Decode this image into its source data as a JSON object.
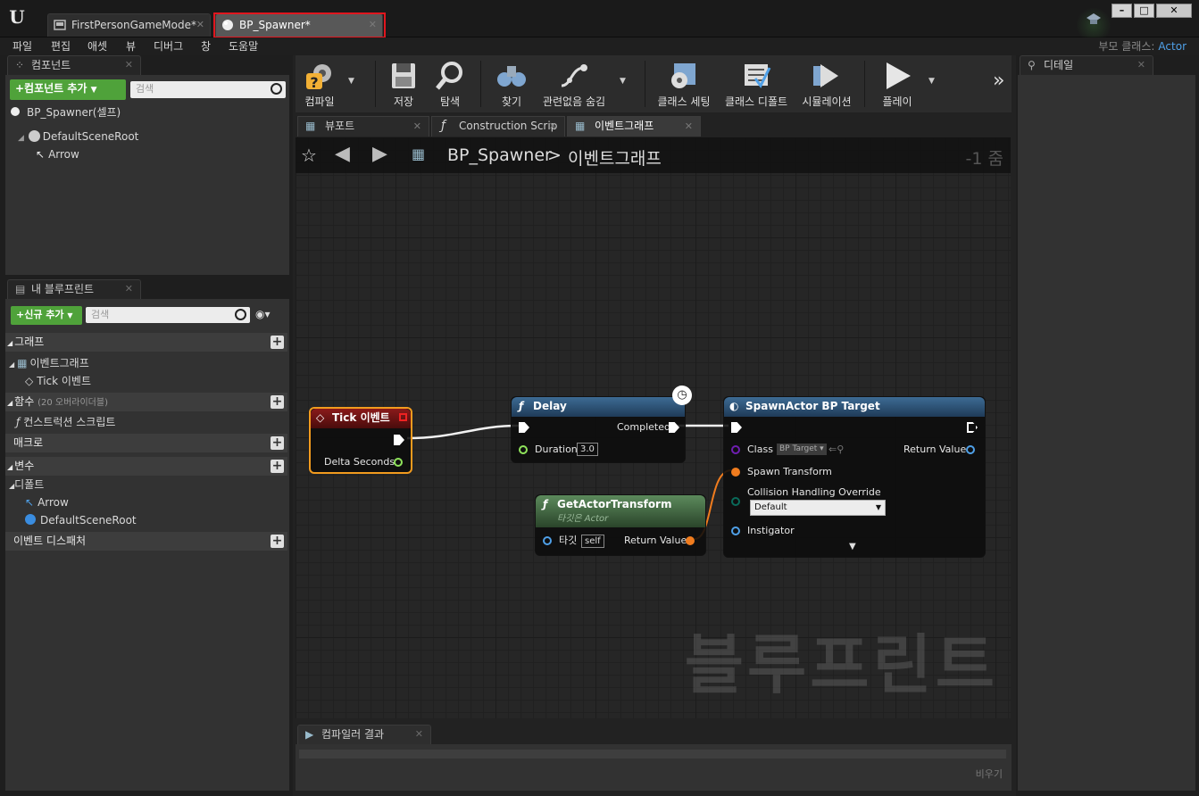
{
  "doc_tabs": [
    {
      "label": "FirstPersonGameMode*"
    },
    {
      "label": "BP_Spawner*"
    }
  ],
  "menu": [
    "파일",
    "편집",
    "애셋",
    "뷰",
    "디버그",
    "창",
    "도움말"
  ],
  "parent_class": {
    "label": "부모 클래스:",
    "value": "Actor"
  },
  "components": {
    "tab": "컴포넌트",
    "add_button": "+컴포넌트 추가",
    "search_placeholder": "검색",
    "self": "BP_Spawner(셀프)",
    "root": "DefaultSceneRoot",
    "child": "Arrow"
  },
  "my_blueprint": {
    "tab": "내 블루프린트",
    "add_button": "+신규 추가",
    "search_placeholder": "검색",
    "graphs_header": "그래프",
    "event_graph": "이벤트그래프",
    "tick_event": "Tick 이벤트",
    "functions_header": "함수",
    "functions_count": "(20 오버라이더블)",
    "construction": "컨스트럭션 스크립트",
    "macros": "매크로",
    "variables": "변수",
    "components_header": "디폴트",
    "comp_arrow": "Arrow",
    "comp_root": "DefaultSceneRoot",
    "dispatchers": "이벤트 디스패처"
  },
  "toolbar": {
    "compile": "컴파일",
    "save": "저장",
    "browse": "탐색",
    "find": "찾기",
    "hide_unrelated": "관련없음 숨김",
    "class_settings": "클래스 세팅",
    "class_defaults": "클래스 디폴트",
    "simulation": "시뮬레이션",
    "play": "플레이",
    "overflow": "»"
  },
  "graph_tabs": [
    {
      "label": "뷰포트"
    },
    {
      "label": "Construction Scrip"
    },
    {
      "label": "이벤트그래프"
    }
  ],
  "breadcrumb": {
    "root": "BP_Spawner",
    "sep": ">",
    "current": "이벤트그래프",
    "zoom": "-1 줌"
  },
  "nodes": {
    "tick": {
      "title": "Tick 이벤트",
      "pin": "Delta Seconds"
    },
    "delay": {
      "title": "Delay",
      "out": "Completed",
      "in": "Duration",
      "value": "3.0"
    },
    "spawn": {
      "title": "SpawnActor BP Target",
      "class_label": "Class",
      "class_value": "BP Target",
      "ret": "Return Value",
      "transform": "Spawn Transform",
      "collision": "Collision Handling Override",
      "collision_value": "Default",
      "instigator": "Instigator"
    },
    "getxf": {
      "title": "GetActorTransform",
      "subtitle": "타깃은 Actor",
      "target": "타깃",
      "target_value": "self",
      "ret": "Return Value"
    }
  },
  "watermark": "블루프린트",
  "compiler": {
    "tab": "컴파일러 결과",
    "clear": "비우기"
  },
  "details": {
    "tab": "디테일"
  },
  "colors": {
    "highlight": "#e0161e",
    "green": "#4fa23a",
    "exec": "#ffffff",
    "float": "#8fe35b",
    "object": "#4fa0e8",
    "struct": "#f07c1e",
    "class": "#6e1eb0"
  }
}
